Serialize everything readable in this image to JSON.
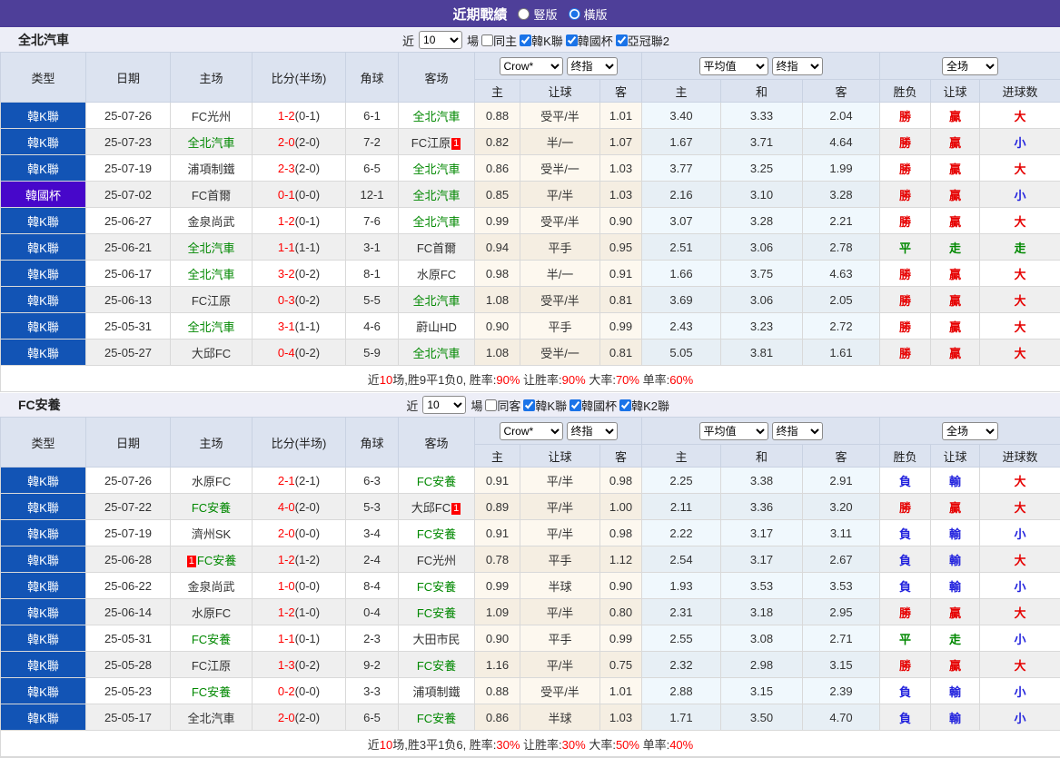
{
  "title_bar": {
    "title": "近期戰績",
    "radio_vertical_label": "豎版",
    "radio_horizontal_label": "橫版",
    "selected_layout": "horizontal"
  },
  "colors": {
    "titlebar": "#4e3f99",
    "league_type": "#1254b5",
    "cup_type": "#4707ca",
    "accent": "#1a73e8",
    "win_red": "#e60000",
    "lose_blue": "#2222dd",
    "draw_green": "#008800",
    "team_green": "#008800",
    "score_red": "#ff0000"
  },
  "controls": {
    "near_label": "近",
    "count_value": "10",
    "matches_label": "場"
  },
  "selects": {
    "bookmaker": "Crow*",
    "handicap_final": "终指",
    "average": "平均值",
    "europe_final": "终指",
    "scope": "全场"
  },
  "columns": {
    "left": [
      "类型",
      "日期",
      "主场",
      "比分(半场)",
      "角球",
      "客场"
    ],
    "sub": [
      "主",
      "让球",
      "客",
      "主",
      "和",
      "客",
      "胜负",
      "让球",
      "进球数"
    ]
  },
  "tables": [
    {
      "team": "全北汽車",
      "same_label": "同主",
      "same_checked": false,
      "leagues": [
        "韓K聯",
        "韓國杯",
        "亞冠聯2"
      ],
      "rows": [
        {
          "type": "韓K聯",
          "cup": false,
          "date": "25-07-26",
          "home": "FC光州",
          "hg": false,
          "hc": false,
          "ft": "1-2",
          "ht": "(0-1)",
          "corner": "6-1",
          "away": "全北汽車",
          "ag": true,
          "ac": false,
          "ah": [
            "0.88",
            "受平/半",
            "1.01"
          ],
          "eu": [
            "3.40",
            "3.33",
            "2.04"
          ],
          "res": [
            [
              "勝",
              "r"
            ],
            [
              "贏",
              "r"
            ],
            [
              "大",
              "r"
            ]
          ]
        },
        {
          "type": "韓K聯",
          "cup": false,
          "date": "25-07-23",
          "home": "全北汽車",
          "hg": true,
          "hc": false,
          "ft": "2-0",
          "ht": "(2-0)",
          "corner": "7-2",
          "away": "FC江原",
          "ag": false,
          "ac": true,
          "ah": [
            "0.82",
            "半/一",
            "1.07"
          ],
          "eu": [
            "1.67",
            "3.71",
            "4.64"
          ],
          "res": [
            [
              "勝",
              "r"
            ],
            [
              "贏",
              "r"
            ],
            [
              "小",
              "b"
            ]
          ]
        },
        {
          "type": "韓K聯",
          "cup": false,
          "date": "25-07-19",
          "home": "浦項制鐵",
          "hg": false,
          "hc": false,
          "ft": "2-3",
          "ht": "(2-0)",
          "corner": "6-5",
          "away": "全北汽車",
          "ag": true,
          "ac": false,
          "ah": [
            "0.86",
            "受半/一",
            "1.03"
          ],
          "eu": [
            "3.77",
            "3.25",
            "1.99"
          ],
          "res": [
            [
              "勝",
              "r"
            ],
            [
              "贏",
              "r"
            ],
            [
              "大",
              "r"
            ]
          ]
        },
        {
          "type": "韓國杯",
          "cup": true,
          "date": "25-07-02",
          "home": "FC首爾",
          "hg": false,
          "hc": false,
          "ft": "0-1",
          "ht": "(0-0)",
          "corner": "12-1",
          "away": "全北汽車",
          "ag": true,
          "ac": false,
          "ah": [
            "0.85",
            "平/半",
            "1.03"
          ],
          "eu": [
            "2.16",
            "3.10",
            "3.28"
          ],
          "res": [
            [
              "勝",
              "r"
            ],
            [
              "贏",
              "r"
            ],
            [
              "小",
              "b"
            ]
          ]
        },
        {
          "type": "韓K聯",
          "cup": false,
          "date": "25-06-27",
          "home": "金泉尚武",
          "hg": false,
          "hc": false,
          "ft": "1-2",
          "ht": "(0-1)",
          "corner": "7-6",
          "away": "全北汽車",
          "ag": true,
          "ac": false,
          "ah": [
            "0.99",
            "受平/半",
            "0.90"
          ],
          "eu": [
            "3.07",
            "3.28",
            "2.21"
          ],
          "res": [
            [
              "勝",
              "r"
            ],
            [
              "贏",
              "r"
            ],
            [
              "大",
              "r"
            ]
          ]
        },
        {
          "type": "韓K聯",
          "cup": false,
          "date": "25-06-21",
          "home": "全北汽車",
          "hg": true,
          "hc": false,
          "ft": "1-1",
          "ht": "(1-1)",
          "corner": "3-1",
          "away": "FC首爾",
          "ag": false,
          "ac": false,
          "ah": [
            "0.94",
            "平手",
            "0.95"
          ],
          "eu": [
            "2.51",
            "3.06",
            "2.78"
          ],
          "res": [
            [
              "平",
              "g"
            ],
            [
              "走",
              "g"
            ],
            [
              "走",
              "g"
            ]
          ]
        },
        {
          "type": "韓K聯",
          "cup": false,
          "date": "25-06-17",
          "home": "全北汽車",
          "hg": true,
          "hc": false,
          "ft": "3-2",
          "ht": "(0-2)",
          "corner": "8-1",
          "away": "水原FC",
          "ag": false,
          "ac": false,
          "ah": [
            "0.98",
            "半/一",
            "0.91"
          ],
          "eu": [
            "1.66",
            "3.75",
            "4.63"
          ],
          "res": [
            [
              "勝",
              "r"
            ],
            [
              "贏",
              "r"
            ],
            [
              "大",
              "r"
            ]
          ]
        },
        {
          "type": "韓K聯",
          "cup": false,
          "date": "25-06-13",
          "home": "FC江原",
          "hg": false,
          "hc": false,
          "ft": "0-3",
          "ht": "(0-2)",
          "corner": "5-5",
          "away": "全北汽車",
          "ag": true,
          "ac": false,
          "ah": [
            "1.08",
            "受平/半",
            "0.81"
          ],
          "eu": [
            "3.69",
            "3.06",
            "2.05"
          ],
          "res": [
            [
              "勝",
              "r"
            ],
            [
              "贏",
              "r"
            ],
            [
              "大",
              "r"
            ]
          ]
        },
        {
          "type": "韓K聯",
          "cup": false,
          "date": "25-05-31",
          "home": "全北汽車",
          "hg": true,
          "hc": false,
          "ft": "3-1",
          "ht": "(1-1)",
          "corner": "4-6",
          "away": "蔚山HD",
          "ag": false,
          "ac": false,
          "ah": [
            "0.90",
            "平手",
            "0.99"
          ],
          "eu": [
            "2.43",
            "3.23",
            "2.72"
          ],
          "res": [
            [
              "勝",
              "r"
            ],
            [
              "贏",
              "r"
            ],
            [
              "大",
              "r"
            ]
          ]
        },
        {
          "type": "韓K聯",
          "cup": false,
          "date": "25-05-27",
          "home": "大邱FC",
          "hg": false,
          "hc": false,
          "ft": "0-4",
          "ht": "(0-2)",
          "corner": "5-9",
          "away": "全北汽車",
          "ag": true,
          "ac": false,
          "ah": [
            "1.08",
            "受半/一",
            "0.81"
          ],
          "eu": [
            "5.05",
            "3.81",
            "1.61"
          ],
          "res": [
            [
              "勝",
              "r"
            ],
            [
              "贏",
              "r"
            ],
            [
              "大",
              "r"
            ]
          ]
        }
      ],
      "summary": [
        {
          "t": "近",
          "red": false
        },
        {
          "t": "10",
          "red": true
        },
        {
          "t": "场,胜9平1负0, 胜率:",
          "red": false
        },
        {
          "t": "90%",
          "red": true
        },
        {
          "t": " 让胜率:",
          "red": false
        },
        {
          "t": "90%",
          "red": true
        },
        {
          "t": " 大率:",
          "red": false
        },
        {
          "t": "70%",
          "red": true
        },
        {
          "t": " 单率:",
          "red": false
        },
        {
          "t": "60%",
          "red": true
        }
      ]
    },
    {
      "team": "FC安養",
      "same_label": "同客",
      "same_checked": false,
      "leagues": [
        "韓K聯",
        "韓國杯",
        "韓K2聯"
      ],
      "rows": [
        {
          "type": "韓K聯",
          "cup": false,
          "date": "25-07-26",
          "home": "水原FC",
          "hg": false,
          "hc": false,
          "ft": "2-1",
          "ht": "(2-1)",
          "corner": "6-3",
          "away": "FC安養",
          "ag": true,
          "ac": false,
          "ah": [
            "0.91",
            "平/半",
            "0.98"
          ],
          "eu": [
            "2.25",
            "3.38",
            "2.91"
          ],
          "res": [
            [
              "負",
              "b"
            ],
            [
              "輸",
              "b"
            ],
            [
              "大",
              "r"
            ]
          ]
        },
        {
          "type": "韓K聯",
          "cup": false,
          "date": "25-07-22",
          "home": "FC安養",
          "hg": true,
          "hc": false,
          "ft": "4-0",
          "ht": "(2-0)",
          "corner": "5-3",
          "away": "大邱FC",
          "ag": false,
          "ac": true,
          "ah": [
            "0.89",
            "平/半",
            "1.00"
          ],
          "eu": [
            "2.11",
            "3.36",
            "3.20"
          ],
          "res": [
            [
              "勝",
              "r"
            ],
            [
              "贏",
              "r"
            ],
            [
              "大",
              "r"
            ]
          ]
        },
        {
          "type": "韓K聯",
          "cup": false,
          "date": "25-07-19",
          "home": "濟州SK",
          "hg": false,
          "hc": false,
          "ft": "2-0",
          "ht": "(0-0)",
          "corner": "3-4",
          "away": "FC安養",
          "ag": true,
          "ac": false,
          "ah": [
            "0.91",
            "平/半",
            "0.98"
          ],
          "eu": [
            "2.22",
            "3.17",
            "3.11"
          ],
          "res": [
            [
              "負",
              "b"
            ],
            [
              "輸",
              "b"
            ],
            [
              "小",
              "b"
            ]
          ]
        },
        {
          "type": "韓K聯",
          "cup": false,
          "date": "25-06-28",
          "home": "FC安養",
          "hg": true,
          "hc": true,
          "ft": "1-2",
          "ht": "(1-2)",
          "corner": "2-4",
          "away": "FC光州",
          "ag": false,
          "ac": false,
          "ah": [
            "0.78",
            "平手",
            "1.12"
          ],
          "eu": [
            "2.54",
            "3.17",
            "2.67"
          ],
          "res": [
            [
              "負",
              "b"
            ],
            [
              "輸",
              "b"
            ],
            [
              "大",
              "r"
            ]
          ]
        },
        {
          "type": "韓K聯",
          "cup": false,
          "date": "25-06-22",
          "home": "金泉尚武",
          "hg": false,
          "hc": false,
          "ft": "1-0",
          "ht": "(0-0)",
          "corner": "8-4",
          "away": "FC安養",
          "ag": true,
          "ac": false,
          "ah": [
            "0.99",
            "半球",
            "0.90"
          ],
          "eu": [
            "1.93",
            "3.53",
            "3.53"
          ],
          "res": [
            [
              "負",
              "b"
            ],
            [
              "輸",
              "b"
            ],
            [
              "小",
              "b"
            ]
          ]
        },
        {
          "type": "韓K聯",
          "cup": false,
          "date": "25-06-14",
          "home": "水原FC",
          "hg": false,
          "hc": false,
          "ft": "1-2",
          "ht": "(1-0)",
          "corner": "0-4",
          "away": "FC安養",
          "ag": true,
          "ac": false,
          "ah": [
            "1.09",
            "平/半",
            "0.80"
          ],
          "eu": [
            "2.31",
            "3.18",
            "2.95"
          ],
          "res": [
            [
              "勝",
              "r"
            ],
            [
              "贏",
              "r"
            ],
            [
              "大",
              "r"
            ]
          ]
        },
        {
          "type": "韓K聯",
          "cup": false,
          "date": "25-05-31",
          "home": "FC安養",
          "hg": true,
          "hc": false,
          "ft": "1-1",
          "ht": "(0-1)",
          "corner": "2-3",
          "away": "大田市民",
          "ag": false,
          "ac": false,
          "ah": [
            "0.90",
            "平手",
            "0.99"
          ],
          "eu": [
            "2.55",
            "3.08",
            "2.71"
          ],
          "res": [
            [
              "平",
              "g"
            ],
            [
              "走",
              "g"
            ],
            [
              "小",
              "b"
            ]
          ]
        },
        {
          "type": "韓K聯",
          "cup": false,
          "date": "25-05-28",
          "home": "FC江原",
          "hg": false,
          "hc": false,
          "ft": "1-3",
          "ht": "(0-2)",
          "corner": "9-2",
          "away": "FC安養",
          "ag": true,
          "ac": false,
          "ah": [
            "1.16",
            "平/半",
            "0.75"
          ],
          "eu": [
            "2.32",
            "2.98",
            "3.15"
          ],
          "res": [
            [
              "勝",
              "r"
            ],
            [
              "贏",
              "r"
            ],
            [
              "大",
              "r"
            ]
          ]
        },
        {
          "type": "韓K聯",
          "cup": false,
          "date": "25-05-23",
          "home": "FC安養",
          "hg": true,
          "hc": false,
          "ft": "0-2",
          "ht": "(0-0)",
          "corner": "3-3",
          "away": "浦項制鐵",
          "ag": false,
          "ac": false,
          "ah": [
            "0.88",
            "受平/半",
            "1.01"
          ],
          "eu": [
            "2.88",
            "3.15",
            "2.39"
          ],
          "res": [
            [
              "負",
              "b"
            ],
            [
              "輸",
              "b"
            ],
            [
              "小",
              "b"
            ]
          ]
        },
        {
          "type": "韓K聯",
          "cup": false,
          "date": "25-05-17",
          "home": "全北汽車",
          "hg": false,
          "hc": false,
          "ft": "2-0",
          "ht": "(2-0)",
          "corner": "6-5",
          "away": "FC安養",
          "ag": true,
          "ac": false,
          "ah": [
            "0.86",
            "半球",
            "1.03"
          ],
          "eu": [
            "1.71",
            "3.50",
            "4.70"
          ],
          "res": [
            [
              "負",
              "b"
            ],
            [
              "輸",
              "b"
            ],
            [
              "小",
              "b"
            ]
          ]
        }
      ],
      "summary": [
        {
          "t": "近",
          "red": false
        },
        {
          "t": "10",
          "red": true
        },
        {
          "t": "场,胜3平1负6, 胜率:",
          "red": false
        },
        {
          "t": "30%",
          "red": true
        },
        {
          "t": " 让胜率:",
          "red": false
        },
        {
          "t": "30%",
          "red": true
        },
        {
          "t": " 大率:",
          "red": false
        },
        {
          "t": "50%",
          "red": true
        },
        {
          "t": " 单率:",
          "red": false
        },
        {
          "t": "40%",
          "red": true
        }
      ]
    }
  ]
}
